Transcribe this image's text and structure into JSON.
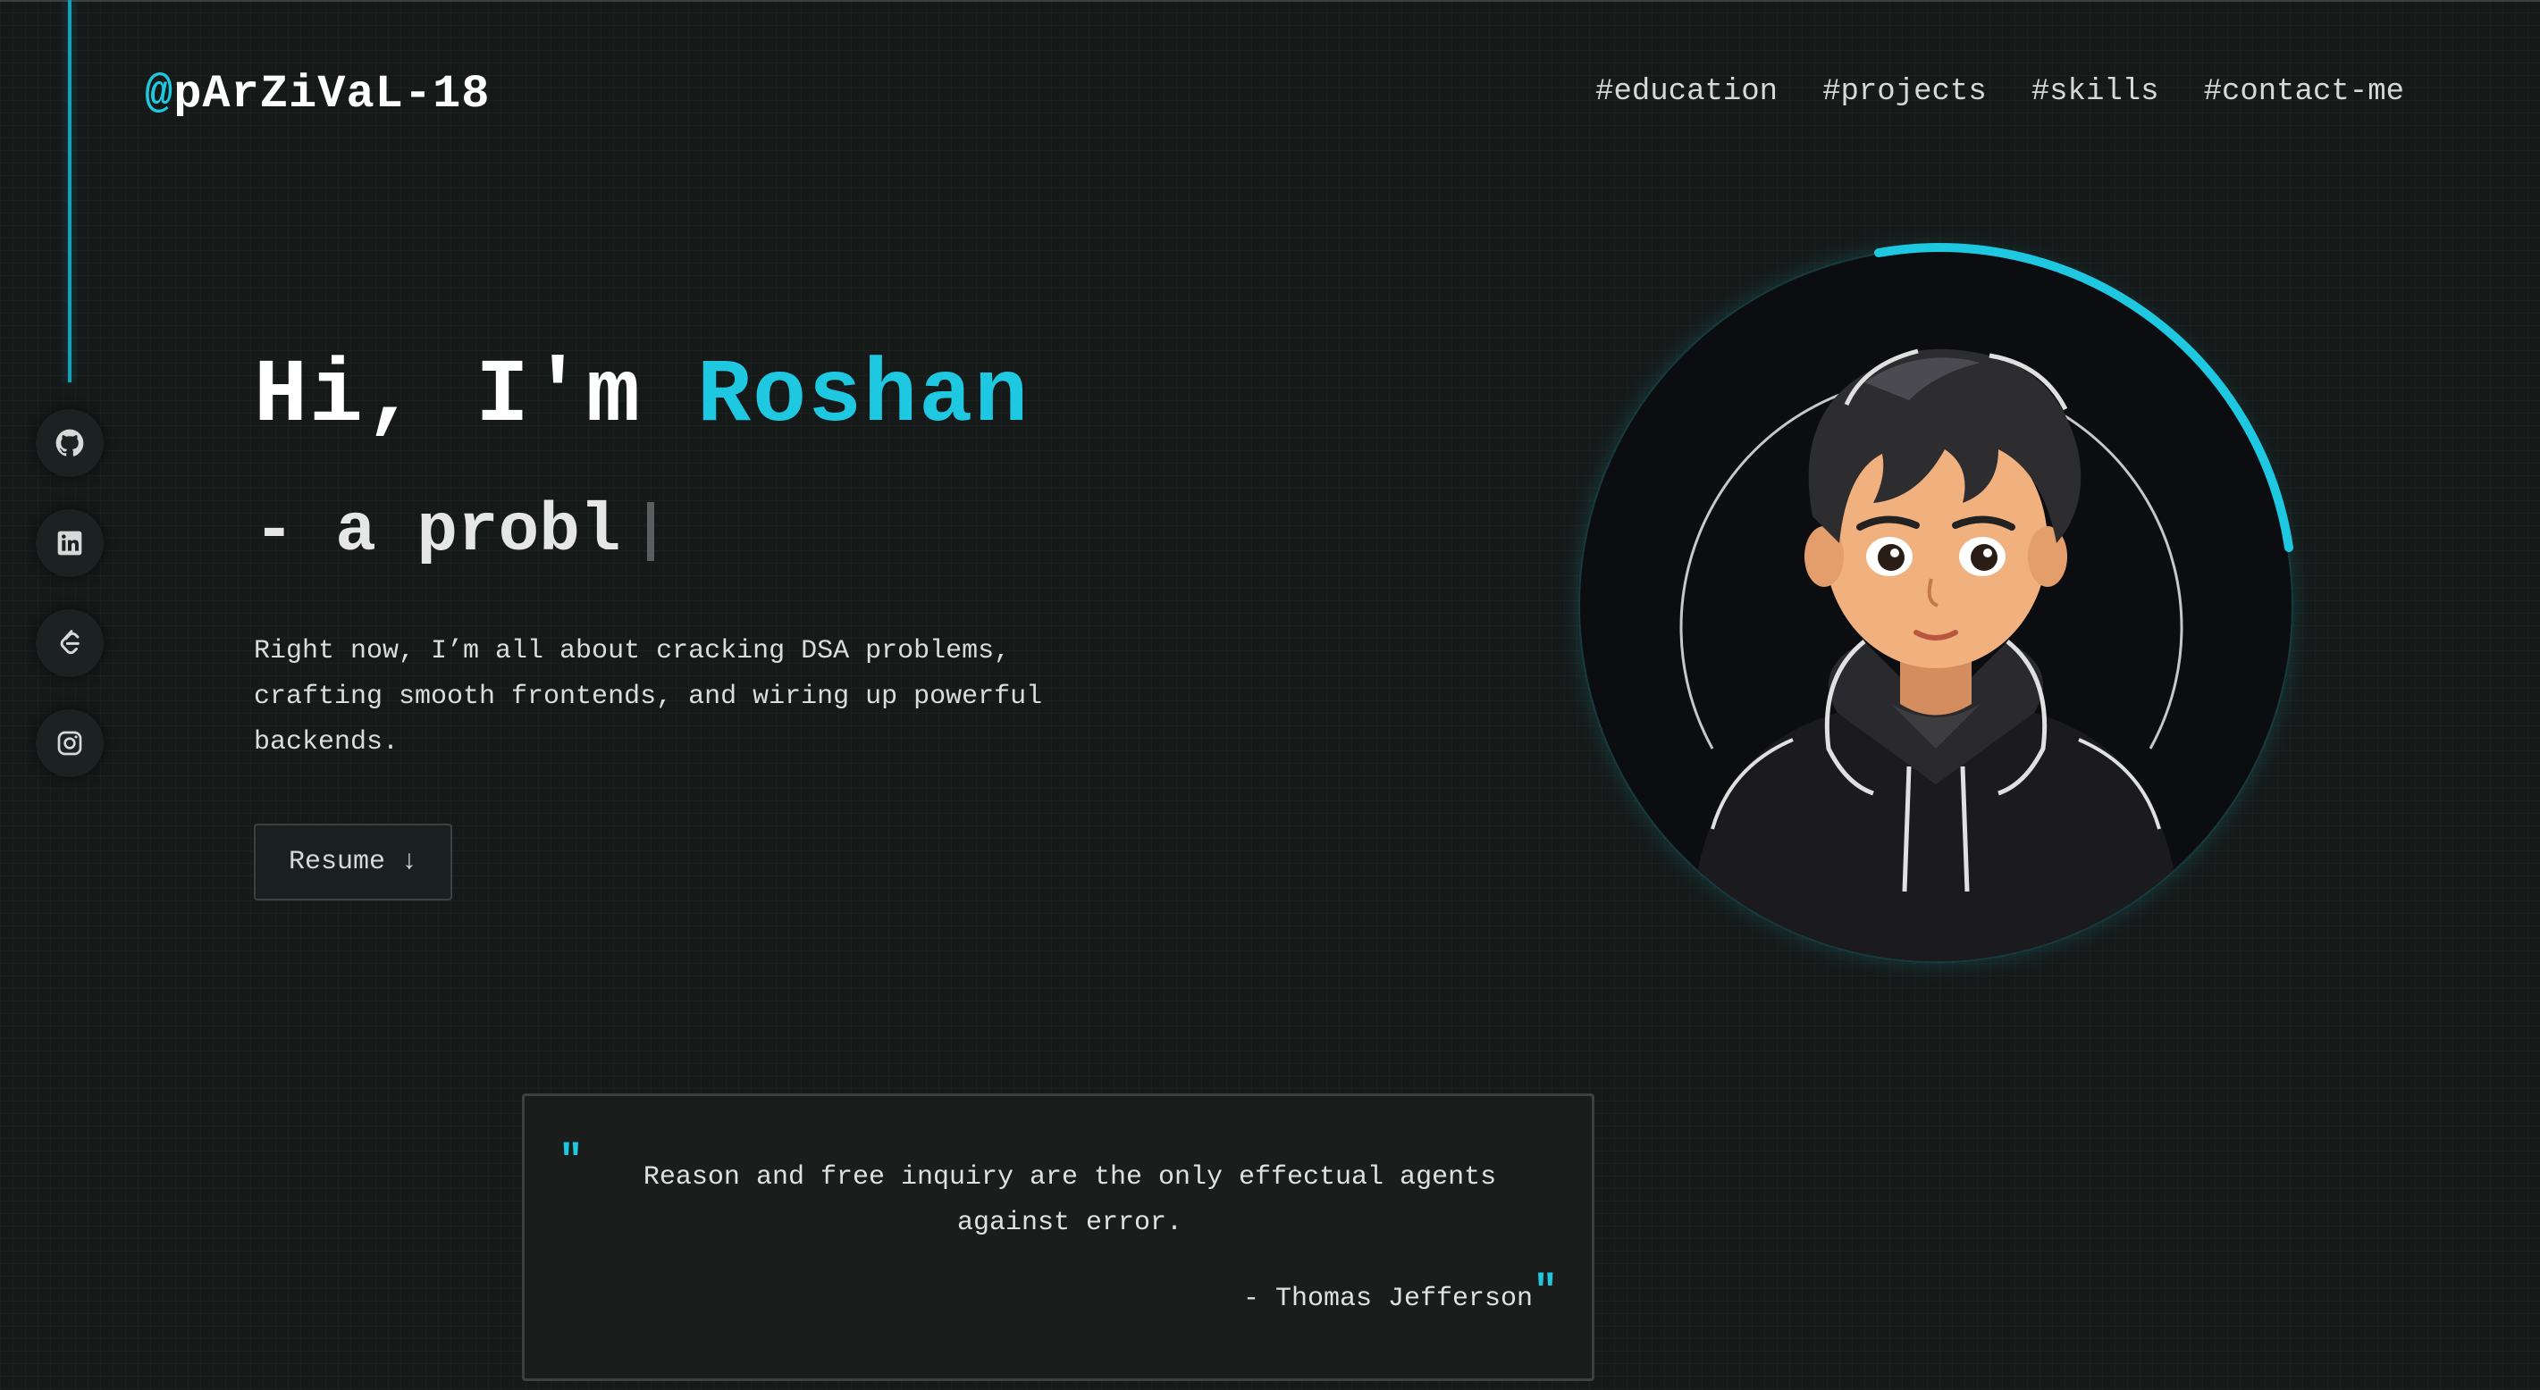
{
  "brand": {
    "at": "@",
    "name": "pArZiVaL-18"
  },
  "nav": {
    "items": [
      "#education",
      "#projects",
      "#skills",
      "#contact-me"
    ]
  },
  "socials": [
    "github-icon",
    "linkedin-icon",
    "leetcode-icon",
    "instagram-icon"
  ],
  "hero": {
    "greeting": "Hi, I'm ",
    "name": "Roshan",
    "typed": "- a probl",
    "description": "Right now, I’m all about cracking DSA problems, crafting smooth frontends, and wiring up powerful backends.",
    "resume_label": "Resume",
    "resume_icon": "↓"
  },
  "quote": {
    "open_mark": "\"",
    "text": "Reason and free inquiry are the only effectual agents against error.",
    "author": "- Thomas Jefferson",
    "close_mark": "\""
  },
  "colors": {
    "accent": "#1ec8e0",
    "background": "#151a19",
    "panel": "#1b1c1c"
  }
}
